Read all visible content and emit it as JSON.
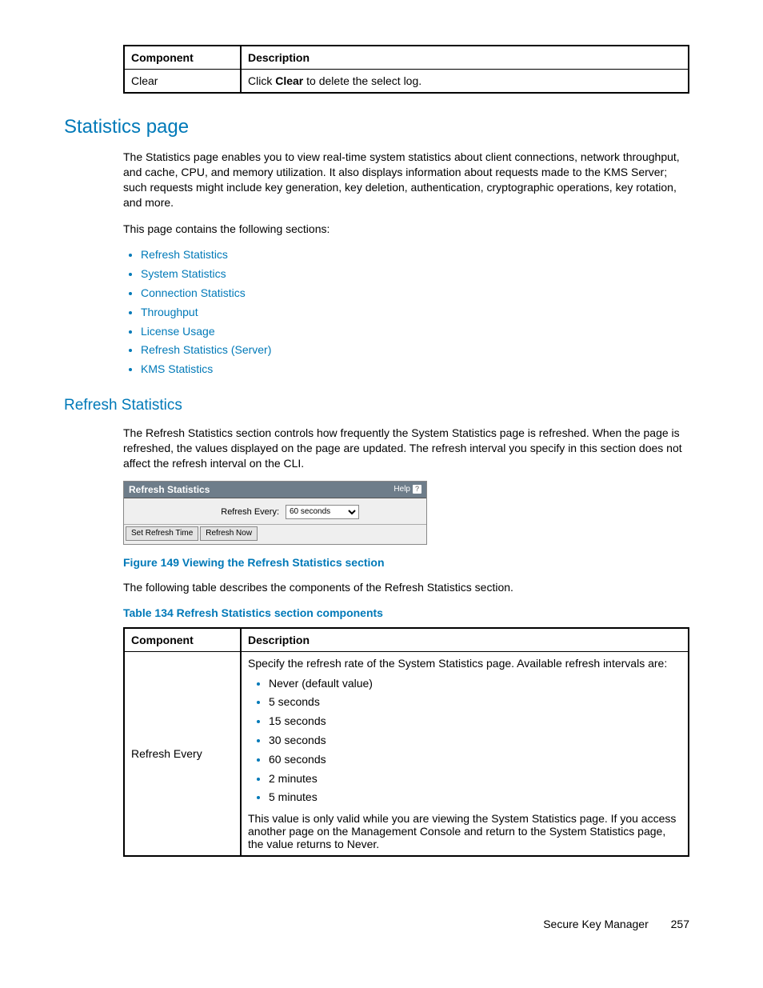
{
  "table1": {
    "header_component": "Component",
    "header_description": "Description",
    "row1_component": "Clear",
    "row1_desc_prefix": "Click ",
    "row1_desc_bold": "Clear",
    "row1_desc_suffix": " to delete the select log."
  },
  "section": {
    "title": "Statistics page",
    "p1": "The Statistics page enables you to view real-time system statistics about client connections, network throughput, and cache, CPU, and memory utilization. It also displays information about requests made to the KMS Server; such requests might include key generation, key deletion, authentication, cryptographic operations, key rotation, and more.",
    "p2": "This page contains the following sections:",
    "links": [
      "Refresh Statistics",
      "System Statistics",
      "Connection Statistics",
      "Throughput",
      "License Usage",
      "Refresh Statistics (Server)",
      "KMS Statistics"
    ]
  },
  "subsection": {
    "title": "Refresh Statistics",
    "p1": "The Refresh Statistics section controls how frequently the System Statistics page is refreshed. When the page is refreshed, the values displayed on the page are updated. The refresh interval you specify in this section does not affect the refresh interval on the CLI."
  },
  "widget": {
    "title": "Refresh Statistics",
    "help": "Help",
    "label": "Refresh Every:",
    "select": "60 seconds",
    "btn1": "Set Refresh Time",
    "btn2": "Refresh Now"
  },
  "figure_caption": "Figure 149 Viewing the Refresh Statistics section",
  "after_figure": "The following table describes the components of the Refresh Statistics section.",
  "table_caption": "Table 134 Refresh Statistics section components",
  "table2": {
    "header_component": "Component",
    "header_description": "Description",
    "row1_component": "Refresh Every",
    "row1_intro": "Specify the refresh rate of the System Statistics page. Available refresh intervals are:",
    "intervals": [
      "Never (default value)",
      "5 seconds",
      "15 seconds",
      "30 seconds",
      "60 seconds",
      "2 minutes",
      "5 minutes"
    ],
    "row1_note": "This value is only valid while you are viewing the System Statistics page. If you access another page on the Management Console and return to the System Statistics page, the value returns to Never."
  },
  "footer": {
    "doc": "Secure Key Manager",
    "page": "257"
  }
}
